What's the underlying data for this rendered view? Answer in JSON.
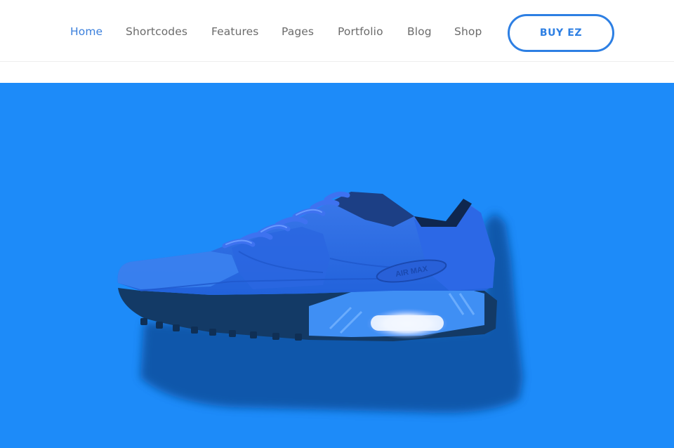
{
  "nav": {
    "items": [
      {
        "label": "Home",
        "active": true
      },
      {
        "label": "Shortcodes",
        "active": false
      },
      {
        "label": "Features",
        "active": false
      },
      {
        "label": "Pages",
        "active": false
      },
      {
        "label": "Portfolio",
        "active": false
      },
      {
        "label": "Blog",
        "active": false
      },
      {
        "label": "Shop",
        "active": false
      }
    ],
    "cta_label": "BUY EZ"
  },
  "hero": {
    "background_color": "#1d8bf9",
    "image": {
      "subject": "blue-running-sneaker",
      "shoe_logo_text": "AIR MAX"
    }
  },
  "colors": {
    "accent": "#2d7fe3",
    "nav_text": "#6b6b6b",
    "hero_bg": "#1d8bf9"
  }
}
